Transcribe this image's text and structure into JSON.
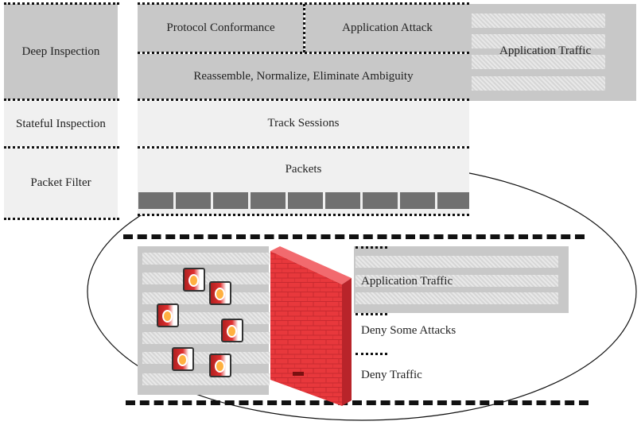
{
  "layers": {
    "deep_inspection": "Deep Inspection",
    "stateful_inspection": "Stateful Inspection",
    "packet_filter": "Packet Filter"
  },
  "stack": {
    "protocol_conformance": "Protocol Conformance",
    "application_attack": "Application Attack",
    "reassemble": "Reassemble, Normalize, Eliminate Ambiguity",
    "track_sessions": "Track Sessions",
    "packets": "Packets"
  },
  "top_traffic": "Application Traffic",
  "firewall": {
    "application_traffic": "Application Traffic",
    "deny_some_attacks": "Deny Some Attacks",
    "deny_traffic": "Deny Traffic"
  },
  "colors": {
    "dark_gray": "#c8c8c8",
    "light_gray": "#f0f0f0",
    "firewall_red": "#e8383c"
  }
}
